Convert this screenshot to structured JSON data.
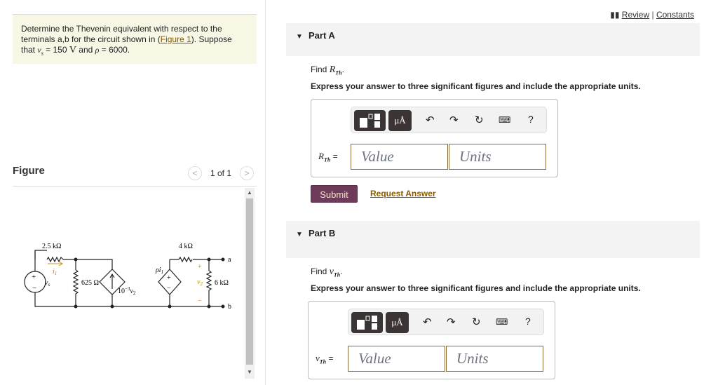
{
  "problem": {
    "text1": "Determine the Thevenin equivalent with respect to the terminals a,b for the circuit shown in (",
    "figure_link": "Figure 1",
    "text2": "). Suppose that ",
    "vs_sym": "v",
    "vs_sub": "s",
    "vs_val": " = 150 ",
    "vs_unit": "V",
    "text3": " and ",
    "rho_sym": "ρ",
    "rho_val": " = 6000."
  },
  "figure": {
    "title": "Figure",
    "pager": "1 of 1",
    "prev": "<",
    "next": ">",
    "circuit": {
      "r1": "2.5 kΩ",
      "r2": "625 Ω",
      "r3": "4 kΩ",
      "r4": "6 kΩ",
      "i1": "i",
      "i1_sub": "1",
      "vs": "v",
      "vs_sub": "s",
      "ccs": "10",
      "ccs_exp": "−3",
      "ccs_var": "v",
      "ccs_sub": "2",
      "vcs": "ρi",
      "vcs_sub": "1",
      "v2": "v",
      "v2_sub": "2",
      "a": "a",
      "b": "b",
      "plus": "+",
      "minus": "−"
    }
  },
  "header": {
    "review": "Review",
    "sep": "|",
    "constants": "Constants"
  },
  "parts": [
    {
      "title": "Part A",
      "find": "Find ",
      "sym": "R",
      "sub": "Th",
      "express": "Express your answer to three significant figures and include the appropriate units.",
      "label": "R",
      "label_sub": "Th",
      "eq": " =",
      "value_ph": "Value",
      "units_ph": "Units",
      "submit": "Submit",
      "request": "Request Answer"
    },
    {
      "title": "Part B",
      "find": "Find ",
      "sym": "v",
      "sub": "Th",
      "express": "Express your answer to three significant figures and include the appropriate units.",
      "label": "v",
      "label_sub": "Th",
      "eq": " =",
      "value_ph": "Value",
      "units_ph": "Units"
    }
  ],
  "toolbar": {
    "units_btn": "μÅ",
    "help": "?"
  }
}
